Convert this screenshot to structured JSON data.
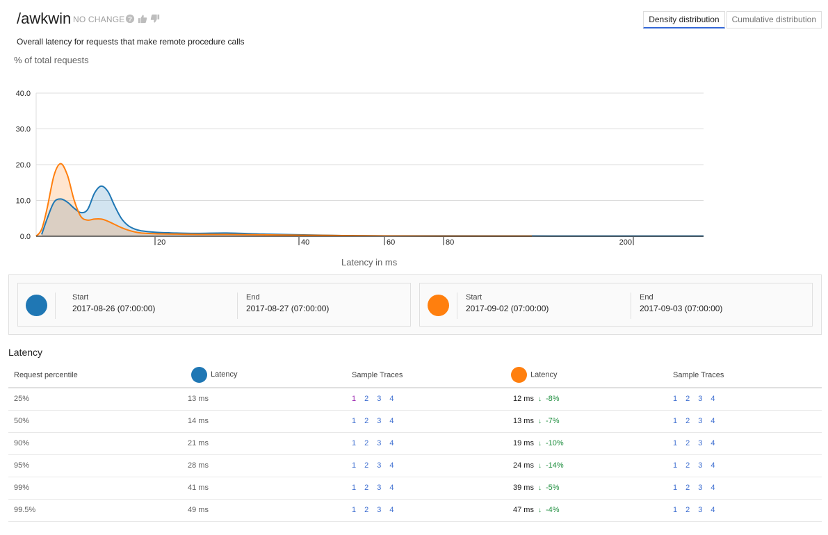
{
  "header": {
    "title": "/awkwin",
    "status": "NO CHANGE",
    "icons": [
      "help-icon",
      "thumbs-up-icon",
      "thumbs-down-icon"
    ],
    "subtitle": "Overall latency for requests that make remote procedure calls"
  },
  "tabs": [
    {
      "label": "Density distribution",
      "active": true
    },
    {
      "label": "Cumulative distribution",
      "active": false
    }
  ],
  "colors": {
    "series1": "#1f77b4",
    "series2": "#ff7f0e",
    "link": "#3f6fd1",
    "link_visited": "#9c27b0",
    "improvement": "#1e8e3e",
    "active_tab": "#3367d6"
  },
  "chart_data": {
    "type": "area",
    "title": "",
    "ylabel": "% of total requests",
    "xlabel": "Latency in ms",
    "ylim": [
      0,
      40
    ],
    "yticks": [
      "0.0",
      "10.0",
      "20.0",
      "30.0",
      "40.0"
    ],
    "xticks": [
      "20",
      "40",
      "60",
      "80",
      "200"
    ],
    "x_scale": "non-linear (bucketed)",
    "grid": true,
    "legend": "below chart (date range cards)",
    "series": [
      {
        "name": "2017-08-26 (07:00:00) – 2017-08-27 (07:00:00)",
        "x": [
          3,
          4,
          5,
          6,
          7,
          8,
          9,
          10,
          11,
          12,
          13,
          14,
          15,
          16,
          17,
          18,
          20,
          23,
          26,
          30,
          35,
          40,
          50,
          60,
          80,
          120,
          200,
          300
        ],
        "values": [
          0.5,
          5,
          9.5,
          10.4,
          9.5,
          7.8,
          6.6,
          7.5,
          12,
          14,
          12.5,
          8.5,
          5,
          3,
          2,
          1.5,
          1.1,
          0.9,
          0.8,
          0.9,
          0.6,
          0.4,
          0.2,
          0.1,
          0.1,
          0.05,
          0.05,
          0.05
        ]
      },
      {
        "name": "2017-09-02 (07:00:00) – 2017-09-03 (07:00:00)",
        "x": [
          2,
          3,
          4,
          5,
          6,
          7,
          8,
          9,
          10,
          11,
          12,
          13,
          14,
          15,
          16,
          17,
          18,
          20,
          23,
          26,
          30,
          35,
          40,
          50,
          60,
          80,
          100
        ],
        "values": [
          0,
          2,
          8,
          17,
          20.3,
          17,
          10,
          5.5,
          4.5,
          4.8,
          4.8,
          4.2,
          3.3,
          2.4,
          1.7,
          1.2,
          0.9,
          0.7,
          0.6,
          0.5,
          0.5,
          0.4,
          0.3,
          0.2,
          0.1,
          0.05,
          0.05
        ]
      }
    ]
  },
  "legend": [
    {
      "color": "#1f77b4",
      "start_label": "Start",
      "start": "2017-08-26 (07:00:00)",
      "end_label": "End",
      "end": "2017-08-27 (07:00:00)"
    },
    {
      "color": "#ff7f0e",
      "start_label": "Start",
      "start": "2017-09-02 (07:00:00)",
      "end_label": "End",
      "end": "2017-09-03 (07:00:00)"
    }
  ],
  "latency_table": {
    "title": "Latency",
    "headers": {
      "percentile": "Request percentile",
      "latency1": "Latency",
      "traces1": "Sample Traces",
      "latency2": "Latency",
      "traces2": "Sample Traces"
    },
    "rows": [
      {
        "percentile": "25%",
        "latency1": "13 ms",
        "latency2": "12 ms",
        "delta": "-8%",
        "traces1": [
          "1",
          "2",
          "3",
          "4"
        ],
        "traces2": [
          "1",
          "2",
          "3",
          "4"
        ],
        "visited1": [
          0
        ]
      },
      {
        "percentile": "50%",
        "latency1": "14 ms",
        "latency2": "13 ms",
        "delta": "-7%",
        "traces1": [
          "1",
          "2",
          "3",
          "4"
        ],
        "traces2": [
          "1",
          "2",
          "3",
          "4"
        ],
        "visited1": []
      },
      {
        "percentile": "90%",
        "latency1": "21 ms",
        "latency2": "19 ms",
        "delta": "-10%",
        "traces1": [
          "1",
          "2",
          "3",
          "4"
        ],
        "traces2": [
          "1",
          "2",
          "3",
          "4"
        ],
        "visited1": []
      },
      {
        "percentile": "95%",
        "latency1": "28 ms",
        "latency2": "24 ms",
        "delta": "-14%",
        "traces1": [
          "1",
          "2",
          "3",
          "4"
        ],
        "traces2": [
          "1",
          "2",
          "3",
          "4"
        ],
        "visited1": []
      },
      {
        "percentile": "99%",
        "latency1": "41 ms",
        "latency2": "39 ms",
        "delta": "-5%",
        "traces1": [
          "1",
          "2",
          "3",
          "4"
        ],
        "traces2": [
          "1",
          "2",
          "3",
          "4"
        ],
        "visited1": []
      },
      {
        "percentile": "99.5%",
        "latency1": "49 ms",
        "latency2": "47 ms",
        "delta": "-4%",
        "traces1": [
          "1",
          "2",
          "3",
          "4"
        ],
        "traces2": [
          "1",
          "2",
          "3",
          "4"
        ],
        "visited1": []
      }
    ],
    "delta_arrow": "↓"
  }
}
